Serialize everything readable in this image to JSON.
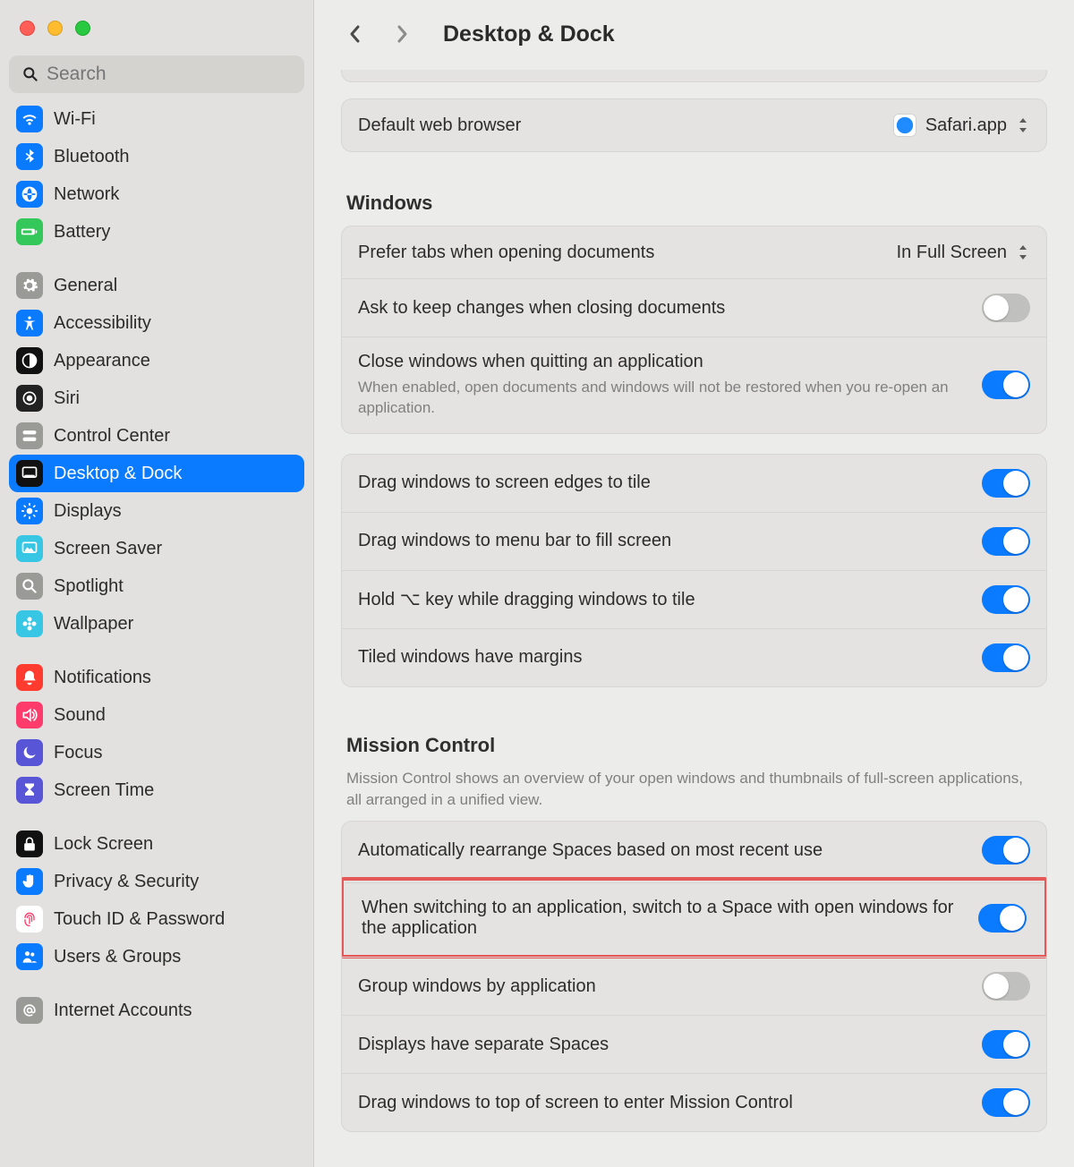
{
  "search": {
    "placeholder": "Search"
  },
  "header": {
    "title": "Desktop & Dock"
  },
  "sidebar": {
    "g0": [
      {
        "label": "Wi-Fi",
        "bg": "#0a7aff",
        "icon": "wifi"
      },
      {
        "label": "Bluetooth",
        "bg": "#0a7aff",
        "icon": "bluetooth"
      },
      {
        "label": "Network",
        "bg": "#0a7aff",
        "icon": "globe"
      },
      {
        "label": "Battery",
        "bg": "#34c759",
        "icon": "battery"
      }
    ],
    "g1": [
      {
        "label": "General",
        "bg": "#9a9a97",
        "icon": "gear"
      },
      {
        "label": "Accessibility",
        "bg": "#0a7aff",
        "icon": "access"
      },
      {
        "label": "Appearance",
        "bg": "#111111",
        "icon": "appearance"
      },
      {
        "label": "Siri",
        "bg": "#222222",
        "icon": "siri"
      },
      {
        "label": "Control Center",
        "bg": "#9a9a97",
        "icon": "switches"
      },
      {
        "label": "Desktop & Dock",
        "bg": "#111111",
        "icon": "dock",
        "selected": true
      },
      {
        "label": "Displays",
        "bg": "#0a7aff",
        "icon": "sun"
      },
      {
        "label": "Screen Saver",
        "bg": "#37c7e4",
        "icon": "screensaver"
      },
      {
        "label": "Spotlight",
        "bg": "#9a9a97",
        "icon": "search"
      },
      {
        "label": "Wallpaper",
        "bg": "#37c7e4",
        "icon": "flower"
      }
    ],
    "g2": [
      {
        "label": "Notifications",
        "bg": "#ff3b30",
        "icon": "bell"
      },
      {
        "label": "Sound",
        "bg": "#ff3b6b",
        "icon": "speaker"
      },
      {
        "label": "Focus",
        "bg": "#5856d6",
        "icon": "moon"
      },
      {
        "label": "Screen Time",
        "bg": "#5856d6",
        "icon": "hourglass"
      }
    ],
    "g3": [
      {
        "label": "Lock Screen",
        "bg": "#111111",
        "icon": "lock"
      },
      {
        "label": "Privacy & Security",
        "bg": "#0a7aff",
        "icon": "hand"
      },
      {
        "label": "Touch ID & Password",
        "bg": "#ffffff",
        "icon": "fingerprint",
        "fg": "#ff3b6b"
      },
      {
        "label": "Users & Groups",
        "bg": "#0a7aff",
        "icon": "users"
      }
    ],
    "g4": [
      {
        "label": "Internet Accounts",
        "bg": "#9a9a97",
        "icon": "at"
      }
    ]
  },
  "browser": {
    "label": "Default web browser",
    "value": "Safari.app"
  },
  "windows": {
    "heading": "Windows",
    "tabs": {
      "label": "Prefer tabs when opening documents",
      "value": "In Full Screen"
    },
    "ask": {
      "label": "Ask to keep changes when closing documents",
      "on": false
    },
    "close": {
      "label": "Close windows when quitting an application",
      "sub": "When enabled, open documents and windows will not be restored when you re-open an application.",
      "on": true
    }
  },
  "tile": {
    "edges": {
      "label": "Drag windows to screen edges to tile",
      "on": true
    },
    "menubar": {
      "label": "Drag windows to menu bar to fill screen",
      "on": true
    },
    "option": {
      "label": "Hold ⌥ key while dragging windows to tile",
      "on": true
    },
    "margins": {
      "label": "Tiled windows have margins",
      "on": true
    }
  },
  "mission": {
    "heading": "Mission Control",
    "sub": "Mission Control shows an overview of your open windows and thumbnails of full-screen applications, all arranged in a unified view.",
    "auto": {
      "label": "Automatically rearrange Spaces based on most recent use",
      "on": true
    },
    "switch": {
      "label": "When switching to an application, switch to a Space with open windows for the application",
      "on": true
    },
    "group": {
      "label": "Group windows by application",
      "on": false
    },
    "displays": {
      "label": "Displays have separate Spaces",
      "on": true
    },
    "dragtop": {
      "label": "Drag windows to top of screen to enter Mission Control",
      "on": true
    }
  }
}
